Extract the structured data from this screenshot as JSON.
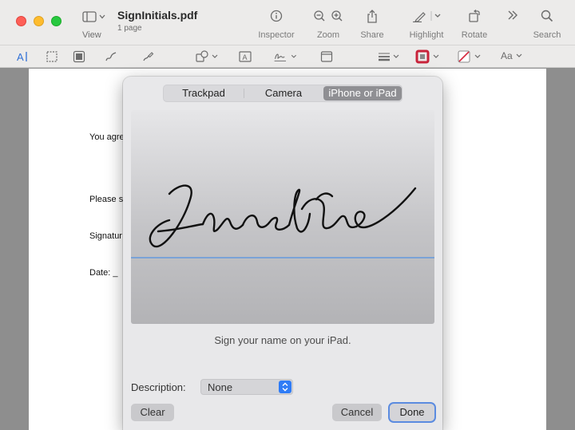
{
  "window": {
    "title": "SignInitials.pdf",
    "subtitle": "1 page"
  },
  "toolbar": {
    "view": "View",
    "inspector": "Inspector",
    "zoom": "Zoom",
    "share": "Share",
    "highlight": "Highlight",
    "rotate": "Rotate",
    "search": "Search"
  },
  "markup": {
    "font_label": "Aa",
    "colors": {
      "border": "#c8233a",
      "accent": "#2f7cf6"
    }
  },
  "document": {
    "lines": [
      "You agre",
      "Please s",
      "Signatur",
      "Date:  _"
    ]
  },
  "signature_sheet": {
    "tabs": [
      {
        "label": "Trackpad",
        "selected": false
      },
      {
        "label": "Camera",
        "selected": false
      },
      {
        "label": "iPhone or iPad",
        "selected": true
      }
    ],
    "instruction": "Sign your name on your iPad.",
    "description_label": "Description:",
    "description_value": "None",
    "buttons": {
      "clear": "Clear",
      "cancel": "Cancel",
      "done": "Done"
    }
  }
}
